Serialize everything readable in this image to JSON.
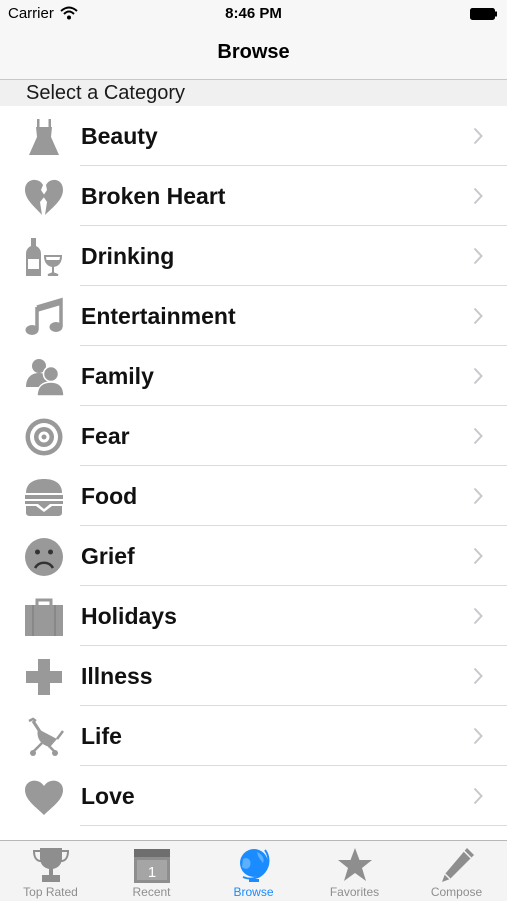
{
  "status_bar": {
    "carrier": "Carrier",
    "time": "8:46 PM"
  },
  "nav": {
    "title": "Browse"
  },
  "section": {
    "title": "Select a Category"
  },
  "categories": [
    {
      "label": "Beauty",
      "icon": "dress-icon"
    },
    {
      "label": "Broken Heart",
      "icon": "broken-heart-icon"
    },
    {
      "label": "Drinking",
      "icon": "wine-bottle-glass-icon"
    },
    {
      "label": "Entertainment",
      "icon": "music-note-icon"
    },
    {
      "label": "Family",
      "icon": "people-icon"
    },
    {
      "label": "Fear",
      "icon": "target-icon"
    },
    {
      "label": "Food",
      "icon": "burger-icon"
    },
    {
      "label": "Grief",
      "icon": "sad-face-icon"
    },
    {
      "label": "Holidays",
      "icon": "suitcase-icon"
    },
    {
      "label": "Illness",
      "icon": "medical-cross-icon"
    },
    {
      "label": "Life",
      "icon": "stroller-icon"
    },
    {
      "label": "Love",
      "icon": "heart-icon"
    }
  ],
  "tabs": [
    {
      "label": "Top Rated",
      "icon": "trophy-icon",
      "active": false
    },
    {
      "label": "Recent",
      "icon": "calendar-icon",
      "active": false
    },
    {
      "label": "Browse",
      "icon": "globe-icon",
      "active": true
    },
    {
      "label": "Favorites",
      "icon": "star-icon",
      "active": false
    },
    {
      "label": "Compose",
      "icon": "pencil-icon",
      "active": false
    }
  ],
  "colors": {
    "icon_gray": "#999999",
    "tab_active": "#1a8cff",
    "tab_inactive": "#8e8e8e"
  }
}
